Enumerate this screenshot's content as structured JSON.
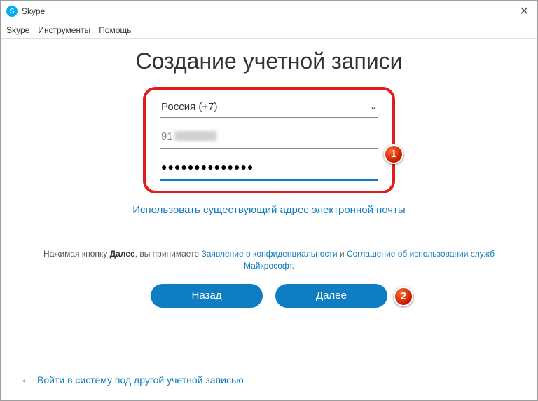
{
  "window": {
    "title": "Skype",
    "close_glyph": "✕"
  },
  "menubar": {
    "skype": "Skype",
    "tools": "Инструменты",
    "help": "Помощь"
  },
  "heading": "Создание учетной записи",
  "form": {
    "country_label": "Россия (+7)",
    "chevron": "⌄",
    "phone_prefix": "91",
    "password_dots": "●●●●●●●●●●●●●●"
  },
  "badges": {
    "one": "1",
    "two": "2"
  },
  "use_email_link": "Использовать существующий адрес электронной почты",
  "terms": {
    "prefix": "Нажимая кнопку ",
    "bold": "Далее",
    "middle": ", вы принимаете ",
    "privacy": "Заявление о конфиденциальности",
    "and": " и ",
    "agreement": "Соглашение об использовании служб Майкрософт",
    "dot": "."
  },
  "buttons": {
    "back": "Назад",
    "next": "Далее"
  },
  "footer": {
    "arrow": "←",
    "text": "Войти в систему под другой учетной записью"
  }
}
